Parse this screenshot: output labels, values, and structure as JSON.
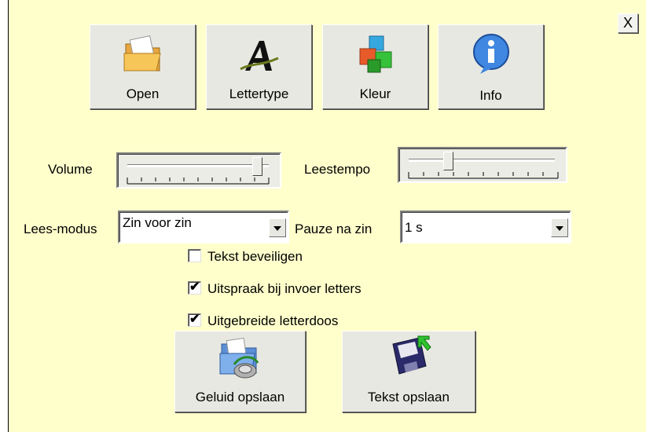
{
  "toolbar": {
    "open_label": "Open",
    "font_label": "Lettertype",
    "color_label": "Kleur",
    "info_label": "Info",
    "close_label": "X"
  },
  "settings": {
    "volume_label": "Volume",
    "volume_level": 0.88,
    "tempo_label": "Leestempo",
    "tempo_level": 0.28,
    "read_mode_label": "Lees-modus",
    "read_mode_value": "Zin voor zin",
    "pause_label": "Pauze na zin",
    "pause_value": "1 s"
  },
  "options": [
    {
      "label": "Tekst beveiligen",
      "checked": false
    },
    {
      "label": "Uitspraak bij invoer letters",
      "checked": true
    },
    {
      "label": "Uitgebreide letterdoos",
      "checked": true
    }
  ],
  "actions": {
    "save_sound_label": "Geluid opslaan",
    "save_text_label": "Tekst opslaan"
  },
  "icons": [
    "folder-icon",
    "font-icon",
    "color-cubes-icon",
    "info-icon",
    "sound-save-icon",
    "floppy-save-icon"
  ]
}
